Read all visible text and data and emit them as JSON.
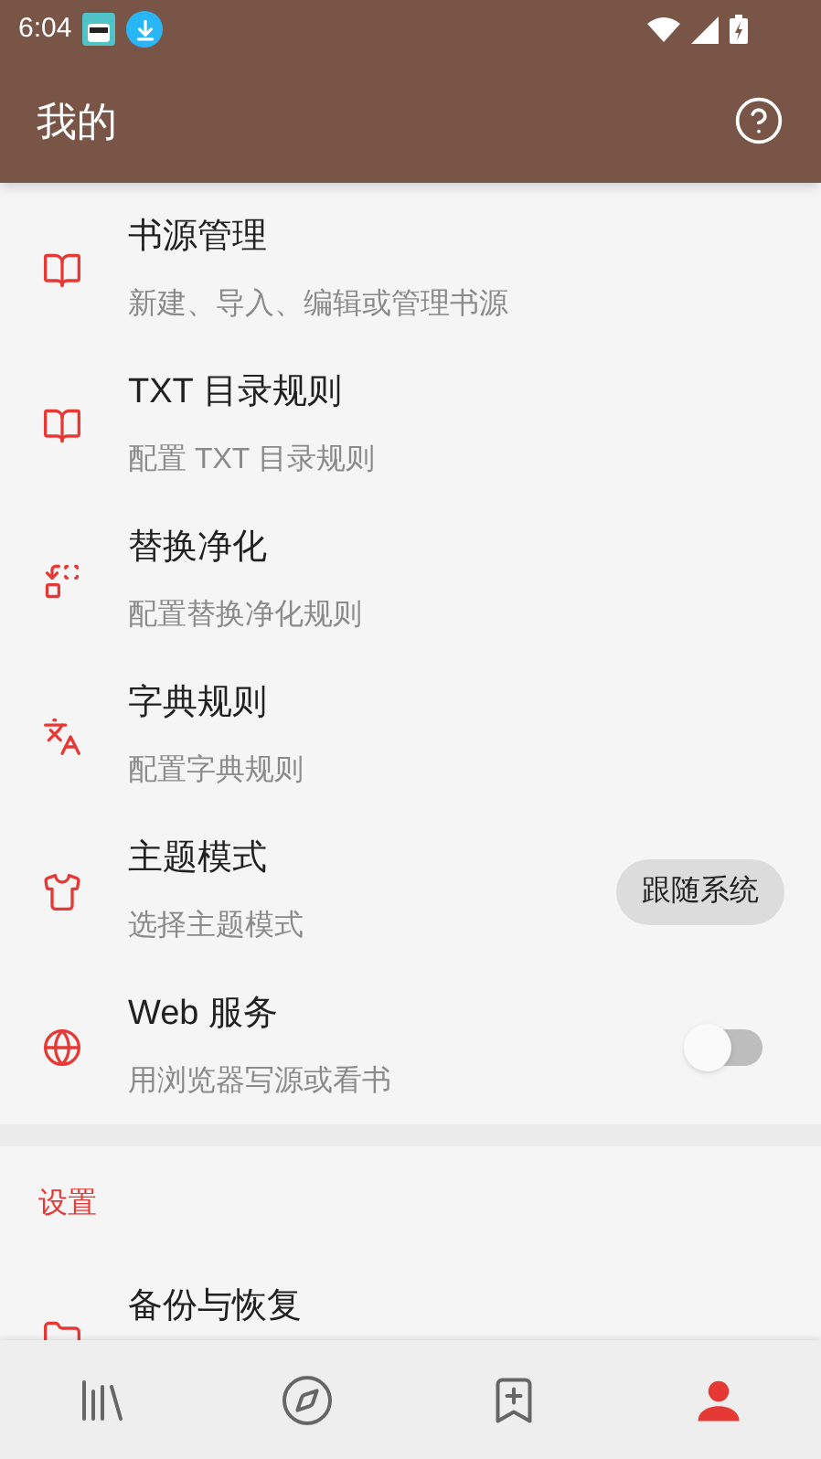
{
  "status_bar": {
    "time": "6:04"
  },
  "toolbar": {
    "title": "我的"
  },
  "items": [
    {
      "title": "书源管理",
      "subtitle": "新建、导入、编辑或管理书源",
      "kind": "plain"
    },
    {
      "title": "TXT 目录规则",
      "subtitle": "配置 TXT 目录规则",
      "kind": "plain"
    },
    {
      "title": "替换净化",
      "subtitle": "配置替换净化规则",
      "kind": "plain"
    },
    {
      "title": "字典规则",
      "subtitle": "配置字典规则",
      "kind": "plain"
    },
    {
      "title": "主题模式",
      "subtitle": "选择主题模式",
      "kind": "chip",
      "value": "跟随系统"
    },
    {
      "title": "Web 服务",
      "subtitle": "用浏览器写源或看书",
      "kind": "switch",
      "on": false
    }
  ],
  "settings": {
    "header": "设置",
    "items": [
      {
        "title": "备份与恢复"
      }
    ]
  },
  "bottom_nav": [
    {
      "selected": false
    },
    {
      "selected": false
    },
    {
      "selected": false
    },
    {
      "selected": true
    }
  ]
}
